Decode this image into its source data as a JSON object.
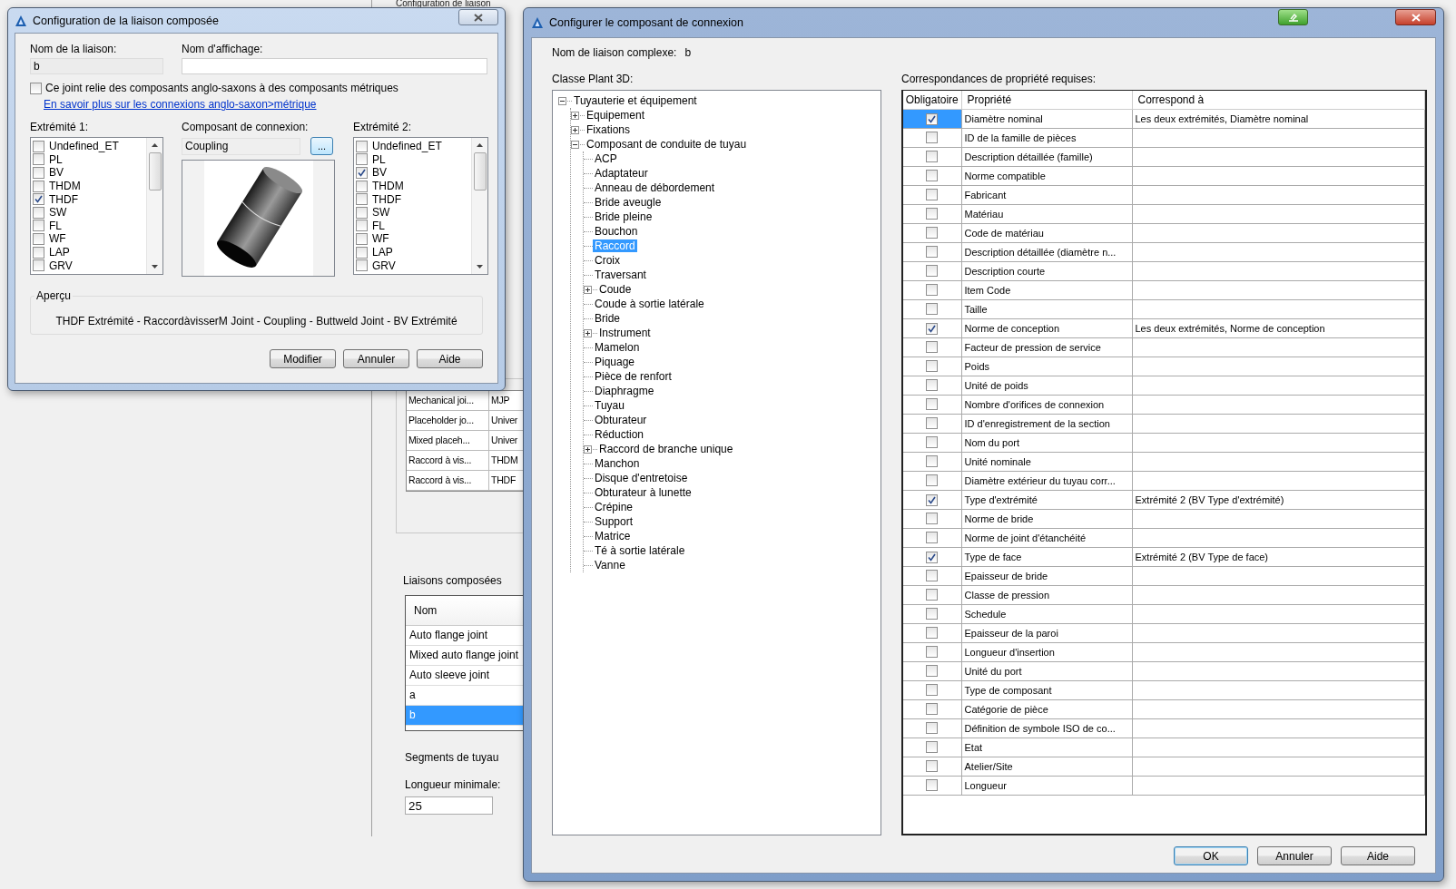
{
  "background": {
    "title": "Configuration de liaison",
    "table_rows": [
      {
        "name": "Mechanical joi...",
        "code": "MJP"
      },
      {
        "name": "Placeholder jo...",
        "code": "Univer"
      },
      {
        "name": "Mixed placeh...",
        "code": "Univer"
      },
      {
        "name": "Raccord à vis...",
        "code": "THDM"
      },
      {
        "name": "Raccord à vis...",
        "code": "THDF"
      }
    ],
    "compound_joints": {
      "label": "Liaisons composées",
      "header": "Nom",
      "items": [
        {
          "label": "Auto flange joint",
          "selected": false
        },
        {
          "label": "Mixed auto flange joint",
          "selected": false
        },
        {
          "label": "Auto sleeve joint",
          "selected": false
        },
        {
          "label": "a",
          "selected": false
        },
        {
          "label": "b",
          "selected": true
        }
      ]
    },
    "pipe_segments": {
      "label": "Segments de tuyau",
      "min_length_label": "Longueur minimale:",
      "min_length": "25"
    }
  },
  "joint_dialog": {
    "title": "Configuration de la liaison composée",
    "name_label": "Nom de la liaison:",
    "name": "b",
    "display_label": "Nom d'affichage:",
    "imperial_metric": {
      "label": "Ce joint relie des composants anglo-saxons à des composants métriques",
      "checked": false
    },
    "link": "En savoir plus sur les connexions anglo-saxon>métrique",
    "end1": {
      "label": "Extrémité 1:",
      "items": [
        {
          "label": "Undefined_ET",
          "checked": false
        },
        {
          "label": "PL",
          "checked": false
        },
        {
          "label": "BV",
          "checked": false
        },
        {
          "label": "THDM",
          "checked": false
        },
        {
          "label": "THDF",
          "checked": true
        },
        {
          "label": "SW",
          "checked": false
        },
        {
          "label": "FL",
          "checked": false
        },
        {
          "label": "WF",
          "checked": false
        },
        {
          "label": "LAP",
          "checked": false
        },
        {
          "label": "GRV",
          "checked": false
        }
      ]
    },
    "connector": {
      "label": "Composant de connexion:",
      "value": "Coupling",
      "browse": "..."
    },
    "end2": {
      "label": "Extrémité 2:",
      "items": [
        {
          "label": "Undefined_ET",
          "checked": false
        },
        {
          "label": "PL",
          "checked": false
        },
        {
          "label": "BV",
          "checked": true
        },
        {
          "label": "THDM",
          "checked": false
        },
        {
          "label": "THDF",
          "checked": false
        },
        {
          "label": "SW",
          "checked": false
        },
        {
          "label": "FL",
          "checked": false
        },
        {
          "label": "WF",
          "checked": false
        },
        {
          "label": "LAP",
          "checked": false
        },
        {
          "label": "GRV",
          "checked": false
        }
      ]
    },
    "preview": {
      "label": "Aperçu",
      "text": "THDF Extrémité - RaccordàvisserM Joint - Coupling - Buttweld Joint - BV Extrémité"
    },
    "buttons": [
      "Modifier",
      "Annuler",
      "Aide"
    ]
  },
  "connector_dialog": {
    "title": "Configurer le composant de connexion",
    "complex_name_label": "Nom de liaison complexe:",
    "complex_name": "b",
    "class_label": "Classe Plant 3D:",
    "tree": [
      {
        "label": "Tuyauterie et équipement",
        "expanded": true,
        "selected": false,
        "children": [
          {
            "label": "Equipement",
            "expanded": false,
            "selected": false
          },
          {
            "label": "Fixations",
            "expanded": false,
            "selected": false
          },
          {
            "label": "Composant de conduite de tuyau",
            "expanded": true,
            "selected": false,
            "children": [
              {
                "label": "ACP",
                "selected": false
              },
              {
                "label": "Adaptateur",
                "selected": false
              },
              {
                "label": "Anneau de débordement",
                "selected": false
              },
              {
                "label": "Bride aveugle",
                "selected": false
              },
              {
                "label": "Bride pleine",
                "selected": false
              },
              {
                "label": "Bouchon",
                "selected": false
              },
              {
                "label": "Raccord",
                "selected": true
              },
              {
                "label": "Croix",
                "selected": false
              },
              {
                "label": "Traversant",
                "selected": false
              },
              {
                "label": "Coude",
                "expanded": false,
                "selected": false
              },
              {
                "label": "Coude à sortie latérale",
                "selected": false
              },
              {
                "label": "Bride",
                "selected": false
              },
              {
                "label": "Instrument",
                "expanded": false,
                "selected": false
              },
              {
                "label": "Mamelon",
                "selected": false
              },
              {
                "label": "Piquage",
                "selected": false
              },
              {
                "label": "Pièce de renfort",
                "selected": false
              },
              {
                "label": "Diaphragme",
                "selected": false
              },
              {
                "label": "Tuyau",
                "selected": false
              },
              {
                "label": "Obturateur",
                "selected": false
              },
              {
                "label": "Réduction",
                "selected": false
              },
              {
                "label": "Raccord de branche unique",
                "expanded": false,
                "selected": false
              },
              {
                "label": "Manchon",
                "selected": false
              },
              {
                "label": "Disque d'entretoise",
                "selected": false
              },
              {
                "label": "Obturateur à lunette",
                "selected": false
              },
              {
                "label": "Crépine",
                "selected": false
              },
              {
                "label": "Support",
                "selected": false
              },
              {
                "label": "Matrice",
                "selected": false
              },
              {
                "label": "Té à sortie latérale",
                "selected": false
              },
              {
                "label": "Vanne",
                "selected": false
              }
            ]
          }
        ]
      }
    ],
    "mappings_label": "Correspondances de propriété requises:",
    "columns": [
      "Obligatoire",
      "Propriété",
      "Correspond à"
    ],
    "rows": [
      {
        "required": true,
        "property": "Diamètre nominal",
        "maps_to": "Les deux extrémités, Diamètre nominal",
        "selected": true
      },
      {
        "required": false,
        "property": "ID de la famille de pièces",
        "selected": false
      },
      {
        "required": false,
        "property": "Description détaillée (famille)",
        "selected": false
      },
      {
        "required": false,
        "property": "Norme compatible",
        "selected": false
      },
      {
        "required": false,
        "property": "Fabricant",
        "selected": false
      },
      {
        "required": false,
        "property": "Matériau",
        "selected": false
      },
      {
        "required": false,
        "property": "Code de matériau",
        "selected": false
      },
      {
        "required": false,
        "property": "Description détaillée (diamètre n...",
        "selected": false
      },
      {
        "required": false,
        "property": "Description courte",
        "selected": false
      },
      {
        "required": false,
        "property": "Item Code",
        "selected": false
      },
      {
        "required": false,
        "property": "Taille",
        "selected": false
      },
      {
        "required": true,
        "property": "Norme de conception",
        "maps_to": "Les deux extrémités, Norme de conception",
        "selected": false
      },
      {
        "required": false,
        "property": "Facteur de pression de service",
        "selected": false
      },
      {
        "required": false,
        "property": "Poids",
        "selected": false
      },
      {
        "required": false,
        "property": "Unité de poids",
        "selected": false
      },
      {
        "required": false,
        "property": "Nombre d'orifices de connexion",
        "selected": false
      },
      {
        "required": false,
        "property": "ID d'enregistrement de la section",
        "selected": false
      },
      {
        "required": false,
        "property": "Nom du port",
        "selected": false
      },
      {
        "required": false,
        "property": "Unité nominale",
        "selected": false
      },
      {
        "required": false,
        "property": "Diamètre extérieur du tuyau corr...",
        "selected": false
      },
      {
        "required": true,
        "property": "Type d'extrémité",
        "maps_to": "Extrémité 2 (BV Type d'extrémité)",
        "selected": false
      },
      {
        "required": false,
        "property": "Norme de bride",
        "selected": false
      },
      {
        "required": false,
        "property": "Norme de joint d'étanchéité",
        "selected": false
      },
      {
        "required": true,
        "property": "Type de face",
        "maps_to": "Extrémité 2 (BV Type de face)",
        "selected": false
      },
      {
        "required": false,
        "property": "Epaisseur de bride",
        "selected": false
      },
      {
        "required": false,
        "property": "Classe de pression",
        "selected": false
      },
      {
        "required": false,
        "property": "Schedule",
        "selected": false
      },
      {
        "required": false,
        "property": "Epaisseur de la paroi",
        "selected": false
      },
      {
        "required": false,
        "property": "Longueur d'insertion",
        "selected": false
      },
      {
        "required": false,
        "property": "Unité du port",
        "selected": false
      },
      {
        "required": false,
        "property": "Type de composant",
        "selected": false
      },
      {
        "required": false,
        "property": "Catégorie de pièce",
        "selected": false
      },
      {
        "required": false,
        "property": "Définition de symbole ISO de co...",
        "selected": false
      },
      {
        "required": false,
        "property": "Etat",
        "selected": false
      },
      {
        "required": false,
        "property": "Atelier/Site",
        "selected": false
      },
      {
        "required": false,
        "property": "Longueur",
        "selected": false
      }
    ],
    "buttons": [
      {
        "label": "OK",
        "default": true
      },
      {
        "label": "Annuler",
        "default": false
      },
      {
        "label": "Aide",
        "default": false
      }
    ]
  }
}
